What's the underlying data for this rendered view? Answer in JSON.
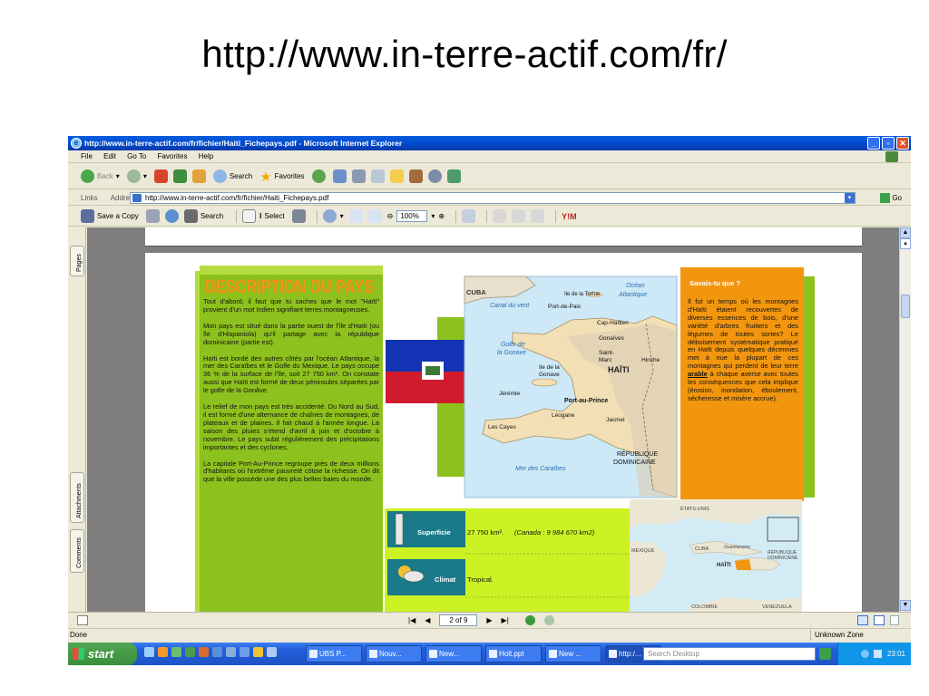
{
  "slide": {
    "title": "http://www.in-terre-actif.com/fr/"
  },
  "window": {
    "title": "http://www.in-terre-actif.com/fr/fichier/Haiti_Fichepays.pdf - Microsoft Internet Explorer"
  },
  "menu": [
    "File",
    "Edit",
    "Go To",
    "Favorites",
    "Help"
  ],
  "std_toolbar": {
    "back": "Back",
    "search": "Search",
    "favorites": "Favorites"
  },
  "address": {
    "links_label": "Links",
    "label": "Address",
    "url": "http://www.in-terre-actif.com/fr/fichier/Haiti_Fichepays.pdf",
    "go": "Go"
  },
  "pdf_toolbar": {
    "save_copy": "Save a Copy",
    "search": "Search",
    "select": "Select",
    "zoom": "100%"
  },
  "side_tabs": [
    "Pages",
    "Attachments",
    "Comments"
  ],
  "page": {
    "heading": "DESCRIPTION DU PAYS",
    "paragraphs": [
      "Tout d'abord, il faut que tu saches que le mot \"Haïti\" provient d'un mot Indien signifiant terres montagneuses.",
      "Mon pays est situé dans la partie ouest de l'île d'Haïti (ou île d'Hispaniola) qu'il partage avec la république dominicaine (partie est).",
      "Haïti est bordé des autres côtés par l'océan Atlantique, la mer des Caraïbes et le Golfe du Mexique. Le pays occupe 36 % de la surface de l'île, soit 27 750 km². On constate aussi que Haïti est formé de deux péninsules séparées par le golfe de la Gonâve.",
      "Le relief de mon pays est très accidenté. Du Nord au Sud, il est formé d'une alternance de chaînes de montagnes, de plateaux et de plaines.  Il fait chaud à l'année longue. La saison des pluies s'étend d'avril à juin et d'octobre à novembre. Le pays subit régulièrement des précipitations importantes et des cyclones.",
      "La capitale Port-Au-Prince regroupe près de deux millions d'habitants où l'extrême pauvreté côtoie la richesse.  On dit que la ville possède une des plus belles baies du monde."
    ],
    "map_labels": {
      "cuba": "CUBA",
      "tortue": "Ile de la Tortue",
      "ocean": "Océan",
      "atlantique": "Atlantique",
      "canal": "Canal du vent",
      "port_de_paix": "Port-de-Paix",
      "cap_haitien": "Cap-Haïtien",
      "gonaives": "Gonaïves",
      "golfe1": "Golfe de",
      "golfe2": "la Gonave",
      "saint1": "Saint-",
      "saint2": "Marc",
      "hinche": "Hinche",
      "ile1": "Ile de la",
      "ile2": "Gonave",
      "haiti": "HAÏTI",
      "jeremie": "Jérémie",
      "pap": "Port-au-Prince",
      "leogane": "Léogane",
      "jacmel": "Jacmel",
      "les_cayes": "Les Cayes",
      "rep1": "RÉPUBLIQUE",
      "rep2": "DOMINICAINE",
      "mer": "Mer des Caraïbes"
    },
    "savais": {
      "title": "Savais-tu que ?",
      "text_before": "Il fut un temps où les montagnes d'Haïti étaient recouvertes de diverses essences de bois, d'une variété d'arbres fruitiers et des légumes de toutes sortes? Le déboisement systématique pratiqué en Haïti depuis quelques décennies met à nue la plupart de ces montagnes qui perdent de leur terre ",
      "text_emph": "arable",
      "text_after": " à chaque averse avec toutes les conséquences que cela implique (érosion, inondation, éboulement, sécheresse et misère accrue)."
    },
    "superficie": {
      "label": "Superficie",
      "value": "27 750 km².",
      "compare": "(Canada : 9 984 670 km2)"
    },
    "climat": {
      "label": "Climat",
      "value": "Tropical."
    },
    "locator": {
      "etats_unis": "ÉTATS-UNIS",
      "cuba": "CUBA",
      "guantanamo": "Guantanamo",
      "mexique": "MEXIQUE",
      "rep1": "RÉPUBLIQUE",
      "rep2": "DOMINICAINE",
      "haiti": "HAÏTI",
      "colombie": "COLOMBIE",
      "venezuela": "VENEZUELA"
    }
  },
  "nav": {
    "page": "2 of 9"
  },
  "status": {
    "left": "Done",
    "zone": "Unknown Zone"
  },
  "taskbar": {
    "start": "start",
    "tasks": [
      "UBS P...",
      "Nouv...",
      "New...",
      "Holt.ppt",
      "New ...",
      "http:/..."
    ],
    "search": "Search Desktop",
    "time": "23:01"
  }
}
